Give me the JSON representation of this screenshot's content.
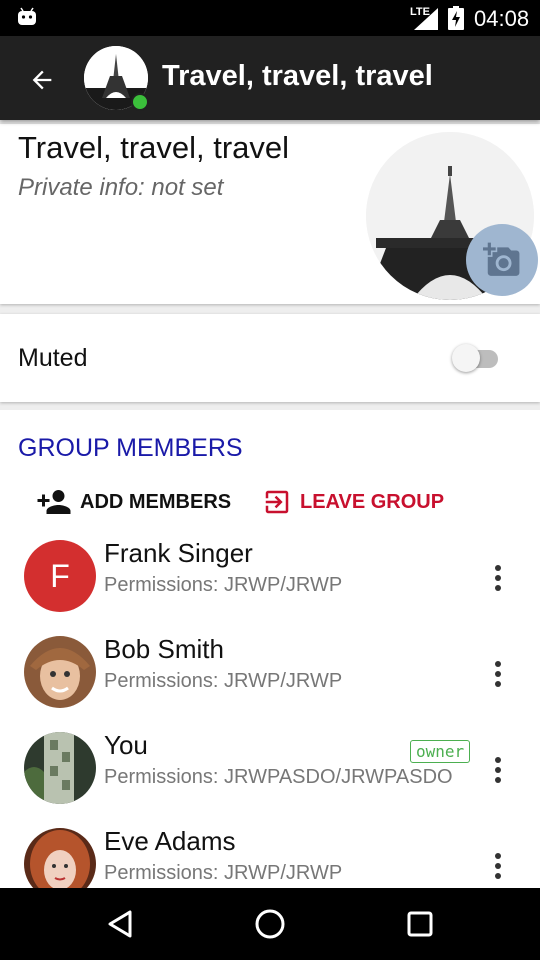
{
  "status_bar": {
    "time": "04:08",
    "network": "LTE"
  },
  "app_bar": {
    "title": "Travel, travel, travel"
  },
  "header_card": {
    "group_name": "Travel, travel, travel",
    "private_info": "Private info: not set"
  },
  "muted": {
    "label": "Muted",
    "enabled": false
  },
  "members_section": {
    "title": "GROUP MEMBERS",
    "add_label": "ADD MEMBERS",
    "leave_label": "LEAVE GROUP",
    "members": [
      {
        "name": "Frank Singer",
        "permissions": "Permissions: JRWP/JRWP",
        "initial": "F",
        "badge": ""
      },
      {
        "name": "Bob Smith",
        "permissions": "Permissions: JRWP/JRWP",
        "initial": "",
        "badge": ""
      },
      {
        "name": "You",
        "permissions": "Permissions: JRWPASDO/JRWPASDO",
        "initial": "",
        "badge": "owner"
      },
      {
        "name": "Eve Adams",
        "permissions": "Permissions: JRWP/JRWP",
        "initial": "",
        "badge": ""
      }
    ]
  },
  "colors": {
    "accent": "#1a1aa8",
    "danger": "#c8102e",
    "app_bar": "#212121",
    "online": "#3bbf3b",
    "owner_badge": "#4caf50"
  },
  "icons": [
    "android-icon",
    "signal-icon",
    "battery-charging-icon",
    "back-arrow-icon",
    "add-photo-icon",
    "add-person-icon",
    "exit-icon",
    "more-vert-icon",
    "nav-back-icon",
    "nav-home-icon",
    "nav-recents-icon"
  ]
}
